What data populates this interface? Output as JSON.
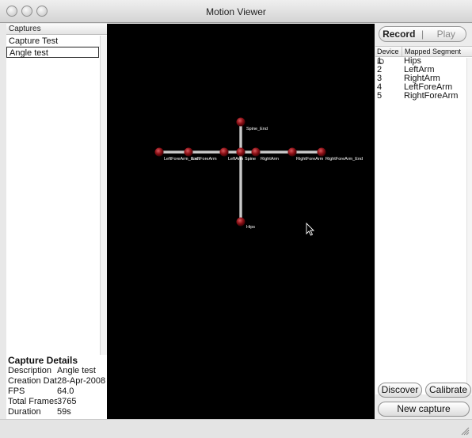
{
  "window": {
    "title": "Motion Viewer"
  },
  "captures": {
    "header": "Captures",
    "items": [
      {
        "label": "Capture Test",
        "selected": false
      },
      {
        "label": "Angle test",
        "selected": true
      }
    ]
  },
  "details": {
    "title": "Capture Details",
    "rows": [
      {
        "key": "Description",
        "value": "Angle test"
      },
      {
        "key": "Creation Date",
        "value": "28-Apr-2008..."
      },
      {
        "key": "FPS",
        "value": "64.0"
      },
      {
        "key": "Total Frames",
        "value": "3765"
      },
      {
        "key": "Duration",
        "value": "59s"
      }
    ]
  },
  "skeleton": {
    "joints": [
      "Spine_End",
      "LeftForeArm_End",
      "LeftForeArm",
      "LeftArm",
      "Spine",
      "RightArm",
      "RightForeArm",
      "RightForeArm_End",
      "Hips"
    ]
  },
  "controls": {
    "record": "Record",
    "separator": "|",
    "play": "Play",
    "discover": "Discover",
    "calibrate": "Calibrate",
    "new_capture": "New capture"
  },
  "devices": {
    "columns": [
      "Device ID",
      "Mapped Segment"
    ],
    "rows": [
      {
        "id": "1",
        "segment": "Hips"
      },
      {
        "id": "2",
        "segment": "LeftArm"
      },
      {
        "id": "3",
        "segment": "RightArm"
      },
      {
        "id": "4",
        "segment": "LeftForeArm"
      },
      {
        "id": "5",
        "segment": "RightForeArm"
      }
    ]
  }
}
